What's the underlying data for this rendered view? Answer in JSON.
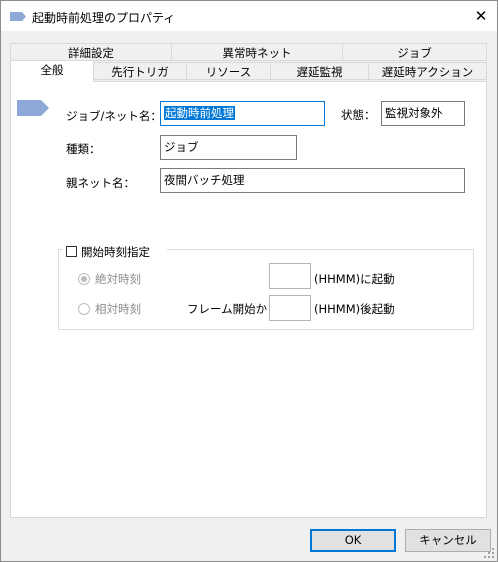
{
  "window": {
    "title": "起動時前処理のプロパティ"
  },
  "tabs_back": [
    "詳細設定",
    "異常時ネット",
    "ジョブ"
  ],
  "tabs_front": [
    "全般",
    "先行トリガ",
    "リソース",
    "遅延監視",
    "遅延時アクション"
  ],
  "general": {
    "job_net_name_label": "ジョブ/ネット名：",
    "job_net_name_value": "起動時前処理",
    "status_label": "状態：",
    "status_value": "監視対象外",
    "type_label": "種類：",
    "type_value": "ジョブ",
    "parent_net_label": "親ネット名：",
    "parent_net_value": "夜間バッチ処理"
  },
  "start_time": {
    "checkbox_label": "開始時刻指定",
    "absolute_label": "絶対時刻",
    "absolute_suffix": "(HHMM)に起動",
    "relative_label": "相対時刻",
    "relative_prefix": "フレーム開始から",
    "relative_suffix": "(HHMM)後起動"
  },
  "buttons": {
    "ok": "OK",
    "cancel": "キャンセル"
  },
  "icons": [
    "job-icon",
    "close-icon",
    "resize-grip-icon"
  ],
  "colors": {
    "selection": "#0078d7",
    "job_icon": "#8ea9d8"
  }
}
